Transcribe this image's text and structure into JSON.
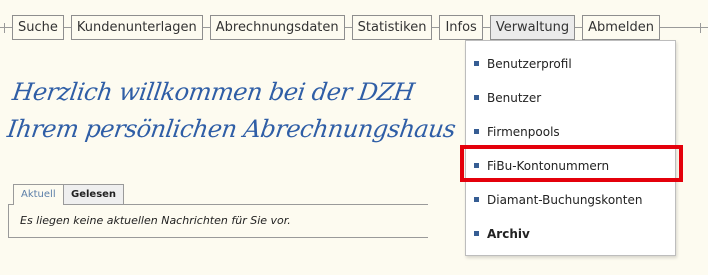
{
  "nav": {
    "items": [
      {
        "label": "Suche"
      },
      {
        "label": "Kundenunterlagen"
      },
      {
        "label": "Abrechnungsdaten"
      },
      {
        "label": "Statistiken"
      },
      {
        "label": "Infos"
      },
      {
        "label": "Verwaltung",
        "active": true
      },
      {
        "label": "Abmelden"
      }
    ]
  },
  "welcome": {
    "line1": "Herzlich willkommen bei der DZH",
    "line2": "Ihrem persönlichen Abrechnungshaus"
  },
  "tabs": {
    "current": "Aktuell",
    "read": "Gelesen"
  },
  "messages": {
    "empty": "Es liegen keine aktuellen Nachrichten für Sie vor."
  },
  "dropdown": {
    "items": [
      {
        "label": "Benutzerprofil"
      },
      {
        "label": "Benutzer"
      },
      {
        "label": "Firmenpools"
      },
      {
        "label": "FiBu-Kontonummern",
        "highlighted": true
      },
      {
        "label": "Diamant-Buchungskonten"
      },
      {
        "label": "Archiv",
        "bold": true
      }
    ]
  },
  "colors": {
    "background": "#fdfbf0",
    "handwriting": "#2f5ea6",
    "bullet": "#365d93",
    "highlight": "#e4000b"
  }
}
